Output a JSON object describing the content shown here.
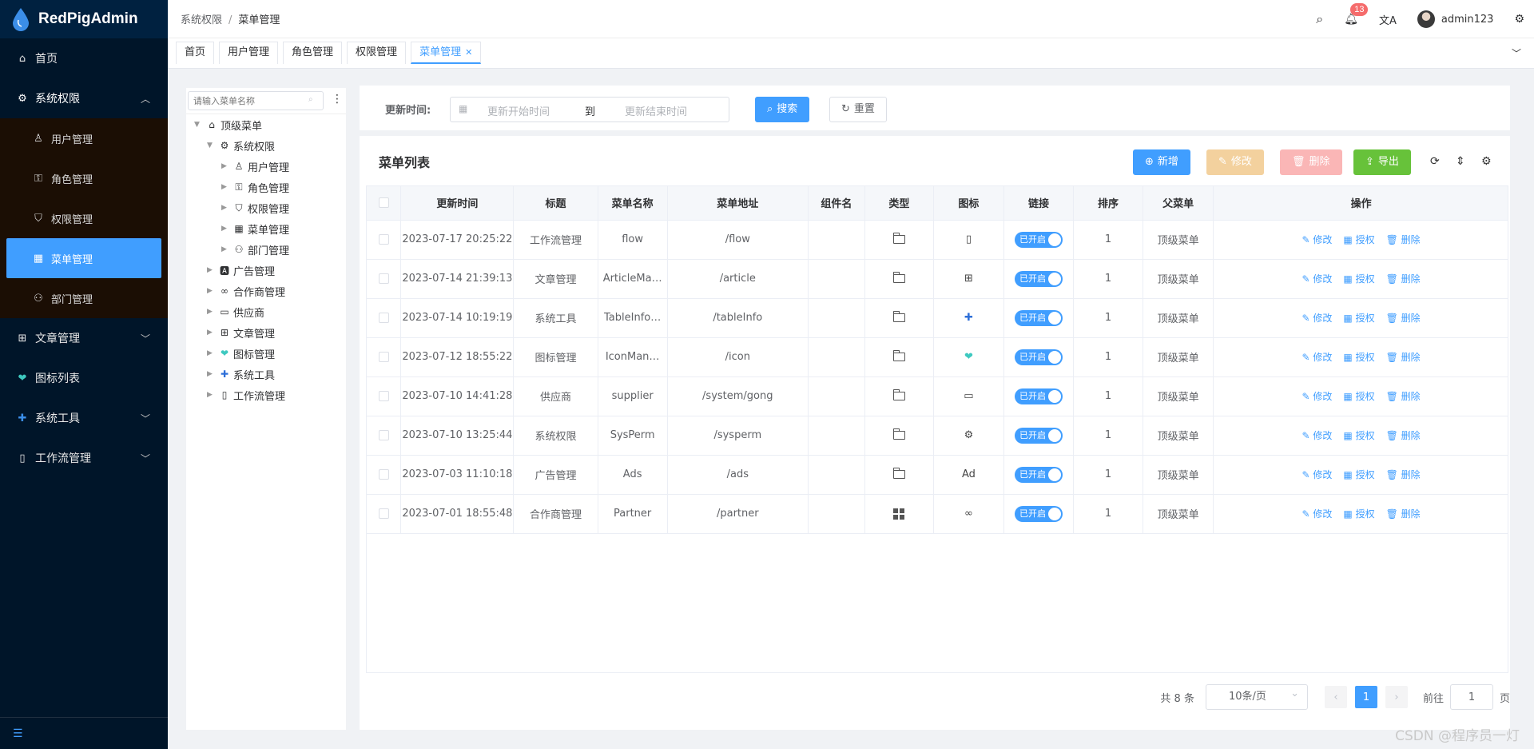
{
  "app": {
    "title": "RedPigAdmin"
  },
  "sidebar": {
    "home": "首页",
    "system": "系统权限",
    "sub": [
      "用户管理",
      "角色管理",
      "权限管理",
      "菜单管理",
      "部门管理"
    ],
    "article": "文章管理",
    "iconlist": "图标列表",
    "tools": "系统工具",
    "workflow": "工作流管理"
  },
  "header": {
    "breadcrumb": [
      "系统权限",
      "菜单管理"
    ],
    "notif_count": "13",
    "user": "admin123"
  },
  "tabs": [
    "首页",
    "用户管理",
    "角色管理",
    "权限管理",
    "菜单管理"
  ],
  "tree": {
    "search_placeholder": "请输入菜单名称",
    "root": "顶级菜单",
    "system": "系统权限",
    "sys_children": [
      "用户管理",
      "角色管理",
      "权限管理",
      "菜单管理",
      "部门管理"
    ],
    "others": [
      "广告管理",
      "合作商管理",
      "供应商",
      "文章管理",
      "图标管理",
      "系统工具",
      "工作流管理"
    ]
  },
  "search": {
    "label": "更新时间:",
    "start_ph": "更新开始时间",
    "to": "到",
    "end_ph": "更新结束时间",
    "search_btn": "搜索",
    "reset_btn": "重置"
  },
  "list": {
    "title": "菜单列表",
    "add": "新增",
    "edit": "修改",
    "del": "删除",
    "export": "导出",
    "columns": [
      "更新时间",
      "标题",
      "菜单名称",
      "菜单地址",
      "组件名",
      "类型",
      "图标",
      "链接",
      "排序",
      "父菜单",
      "操作"
    ],
    "switch_text": "已开启",
    "op_edit": "修改",
    "op_auth": "授权",
    "op_del": "删除",
    "rows": [
      {
        "time": "2023-07-17 20:25:22",
        "title": "工作流管理",
        "name": "flow",
        "path": "/flow",
        "sort": "1",
        "parent": "顶级菜单",
        "type": "folder",
        "icon": "book-icon"
      },
      {
        "time": "2023-07-14 21:39:13",
        "title": "文章管理",
        "name": "ArticleMa…",
        "path": "/article",
        "sort": "1",
        "parent": "顶级菜单",
        "type": "folder",
        "icon": "plus-square-icon"
      },
      {
        "time": "2023-07-14 10:19:19",
        "title": "系统工具",
        "name": "TableInfo…",
        "path": "/tableInfo",
        "sort": "1",
        "parent": "顶级菜单",
        "type": "folder",
        "icon": "blue-plus-icon"
      },
      {
        "time": "2023-07-12 18:55:22",
        "title": "图标管理",
        "name": "IconMan…",
        "path": "/icon",
        "sort": "1",
        "parent": "顶级菜单",
        "type": "folder",
        "icon": "heart-pulse-icon"
      },
      {
        "time": "2023-07-10 14:41:28",
        "title": "供应商",
        "name": "supplier",
        "path": "/system/gong",
        "sort": "1",
        "parent": "顶级菜单",
        "type": "folder",
        "icon": "id-card-icon"
      },
      {
        "time": "2023-07-10 13:25:44",
        "title": "系统权限",
        "name": "SysPerm",
        "path": "/sysperm",
        "sort": "1",
        "parent": "顶级菜单",
        "type": "folder",
        "icon": "gear-icon"
      },
      {
        "time": "2023-07-03 11:10:18",
        "title": "广告管理",
        "name": "Ads",
        "path": "/ads",
        "sort": "1",
        "parent": "顶级菜单",
        "type": "folder",
        "icon": "ad-icon"
      },
      {
        "time": "2023-07-01 18:55:48",
        "title": "合作商管理",
        "name": "Partner",
        "path": "/partner",
        "sort": "1",
        "parent": "顶级菜单",
        "type": "grid",
        "icon": "handshake-icon"
      }
    ]
  },
  "pager": {
    "total": "共 8 条",
    "size": "10条/页",
    "current": "1",
    "goto": "前往",
    "goto_val": "1",
    "page_unit": "页"
  },
  "watermark": "CSDN @程序员一灯"
}
